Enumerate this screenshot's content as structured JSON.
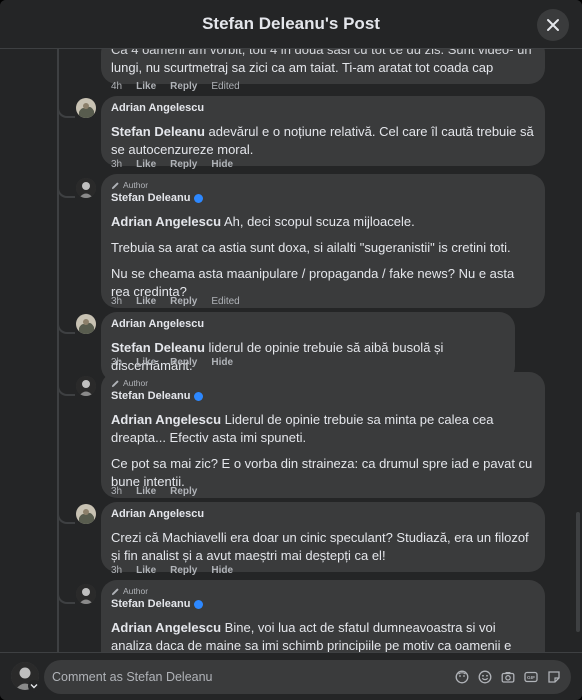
{
  "header": {
    "title": "Stefan Deleanu's Post"
  },
  "top_fragment": {
    "line1": "Ca 4 oameni am vorbit, toti 4 in doua sasi cu tot ce du zis. Sunt video- un",
    "line2": "lungi, nu scurtmetraj sa zici ca am taiat. Ti-am aratat tot coada cap",
    "time": "4h",
    "like": "Like",
    "reply": "Reply",
    "extra": "Edited"
  },
  "comments": [
    {
      "author": "Adrian Angelescu",
      "is_author": false,
      "verified": false,
      "tag": "Stefan Deleanu",
      "paragraphs": [
        "adevărul e o noțiune relativă. Cel care îl caută trebuie să se autocenzureze moral."
      ],
      "time": "3h",
      "like": "Like",
      "reply": "Reply",
      "extra": "Hide"
    },
    {
      "author": "Stefan Deleanu",
      "is_author": true,
      "verified": true,
      "badge": "Author",
      "tag": "Adrian Angelescu",
      "paragraphs": [
        "Ah, deci scopul scuza mijloacele.",
        "Trebuia sa arat ca astia sunt doxa, si ailalti \"sugeranistii\" is cretini toti.",
        "Nu se cheama asta maanipulare / propaganda / fake news? Nu e asta rea credinta?"
      ],
      "time": "3h",
      "like": "Like",
      "reply": "Reply",
      "extra": "Edited"
    },
    {
      "author": "Adrian Angelescu",
      "is_author": false,
      "verified": false,
      "tag": "Stefan Deleanu",
      "paragraphs": [
        "liderul de opinie trebuie să aibă busolă și discernământ."
      ],
      "time": "3h",
      "like": "Like",
      "reply": "Reply",
      "extra": "Hide"
    },
    {
      "author": "Stefan Deleanu",
      "is_author": true,
      "verified": true,
      "badge": "Author",
      "tag": "Adrian Angelescu",
      "paragraphs": [
        "Liderul de opinie trebuie sa minta pe calea cea dreapta... Efectiv asta imi spuneti.",
        "Ce pot sa mai zic? E o vorba din straineza: ca drumul spre iad e pavat cu bune intentii."
      ],
      "time": "3h",
      "like": "Like",
      "reply": "Reply",
      "extra": ""
    },
    {
      "author": "Adrian Angelescu",
      "is_author": false,
      "verified": false,
      "tag": "",
      "paragraphs": [
        "Crezi că Machiavelli era doar un cinic speculant? Studiază, era un filozof și fin analist și a avut maeștri mai deștepți ca el!"
      ],
      "time": "3h",
      "like": "Like",
      "reply": "Reply",
      "extra": "Hide"
    },
    {
      "author": "Stefan Deleanu",
      "is_author": true,
      "verified": true,
      "badge": "Author",
      "tag": "Adrian Angelescu",
      "paragraphs": [
        "Bine, voi lua act de sfatul dumneavoastra si voi analiza daca de maine sa imi schimb principiile pe motiv ca oamenii e prosti si nu e bine sa fie"
      ],
      "time": "",
      "like": "",
      "reply": "",
      "extra": ""
    }
  ],
  "footer": {
    "placeholder": "Comment as Stefan Deleanu",
    "icons": [
      "avatar-icon",
      "sticker-icon",
      "emoji-icon",
      "camera-icon",
      "gif-icon",
      "stickers-icon"
    ]
  },
  "colors": {
    "background": "#242526",
    "bubble": "#3a3b3c",
    "text": "#e4e6eb",
    "muted": "#b0b3b8",
    "verified": "#2d88ff"
  }
}
